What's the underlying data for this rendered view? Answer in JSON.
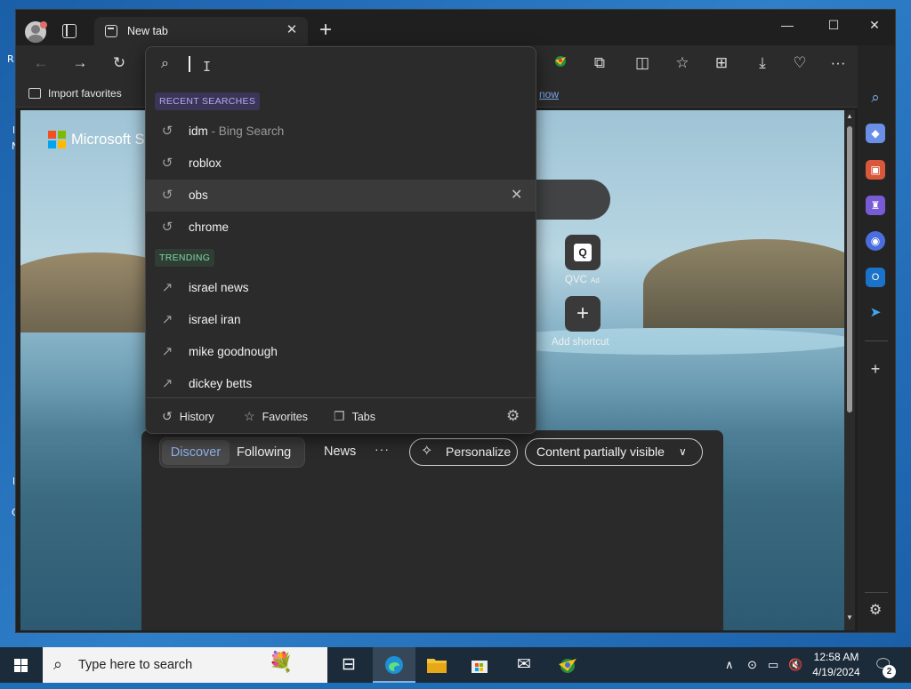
{
  "desktop": {
    "left_fragments": [
      "R",
      "l",
      "N",
      "l",
      "C"
    ]
  },
  "window": {
    "tab_title": "New tab",
    "tab_close": "✕",
    "new_tab": "+",
    "minimize": "—",
    "maximize": "☐",
    "close": "✕"
  },
  "toolbar": {
    "back": "←",
    "forward": "→",
    "refresh": "↻",
    "extensions": "⧉",
    "split": "◫",
    "favorites": "☆",
    "collections": "⊞",
    "downloads": "⤓",
    "health": "♡",
    "more": "···"
  },
  "favbar": {
    "import_favorites": "Import favorites",
    "manage_link": "now"
  },
  "dropdown": {
    "search_icon": "⌕",
    "ibeam": "I",
    "recent_label": "RECENT SEARCHES",
    "recent": [
      {
        "text": "idm",
        "suffix": " - Bing Search"
      },
      {
        "text": "roblox",
        "suffix": ""
      },
      {
        "text": "obs",
        "suffix": ""
      },
      {
        "text": "chrome",
        "suffix": ""
      }
    ],
    "trending_label": "TRENDING",
    "trending": [
      {
        "text": "israel news"
      },
      {
        "text": "israel iran"
      },
      {
        "text": "mike goodnough"
      },
      {
        "text": "dickey betts"
      }
    ],
    "history_icon": "↺",
    "trending_icon": "↗",
    "remove_icon": "✕",
    "footer": {
      "history": "History",
      "favorites": "Favorites",
      "tabs": "Tabs"
    }
  },
  "page": {
    "brand": "Microsoft S",
    "shortcut_label": "QVC",
    "shortcut_ad": "Ad",
    "add_shortcut": "Add shortcut",
    "feed": {
      "discover": "Discover",
      "following": "Following",
      "news": "News",
      "more": "···",
      "personalize": "Personalize",
      "content": "Content partially visible"
    }
  },
  "taskbar": {
    "search_placeholder": "Type here to search",
    "time": "12:58 AM",
    "date": "4/19/2024",
    "notifications": "2"
  },
  "colors": {
    "accent": "#8fb0ef",
    "recent_label_bg": "#3b3557",
    "recent_label_fg": "#b8a8f0",
    "trending_label_bg": "#2f3d35",
    "trending_label_fg": "#7fd6a2"
  }
}
